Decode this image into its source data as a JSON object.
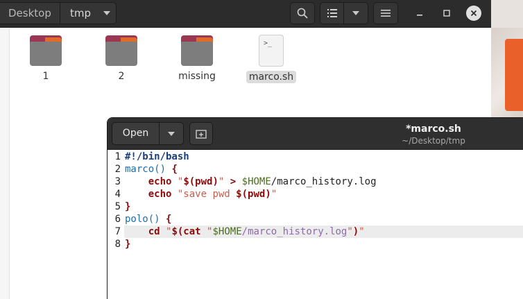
{
  "file_manager": {
    "pathbar": {
      "root": "Desktop",
      "current": "tmp"
    },
    "items": [
      {
        "label": "1",
        "type": "folder"
      },
      {
        "label": "2",
        "type": "folder"
      },
      {
        "label": "missing",
        "type": "folder"
      },
      {
        "label": "marco.sh",
        "type": "script",
        "icon_text": ">_",
        "selected": true
      }
    ]
  },
  "editor": {
    "open_label": "Open",
    "title": "*marco.sh",
    "subtitle": "~/Desktop/tmp",
    "current_line": 7,
    "line_numbers": [
      "1",
      "2",
      "3",
      "4",
      "5",
      "6",
      "7",
      "8"
    ],
    "lines": [
      {
        "indent": "",
        "tokens": [
          {
            "t": "#!/bin/bash",
            "c": "shebang"
          }
        ]
      },
      {
        "indent": "",
        "tokens": [
          {
            "t": "marco()",
            "c": "func"
          },
          {
            "t": " ",
            "c": "plain"
          },
          {
            "t": "{",
            "c": "kw"
          }
        ]
      },
      {
        "indent": "    ",
        "tokens": [
          {
            "t": "echo",
            "c": "kw"
          },
          {
            "t": " ",
            "c": "plain"
          },
          {
            "t": "\"",
            "c": "strlight"
          },
          {
            "t": "$(pwd)",
            "c": "kw"
          },
          {
            "t": "\"",
            "c": "strlight"
          },
          {
            "t": " ",
            "c": "plain"
          },
          {
            "t": ">",
            "c": "kw"
          },
          {
            "t": " ",
            "c": "plain"
          },
          {
            "t": "$HOME",
            "c": "var"
          },
          {
            "t": "/marco_history.log",
            "c": "plain"
          }
        ]
      },
      {
        "indent": "    ",
        "tokens": [
          {
            "t": "echo",
            "c": "kw"
          },
          {
            "t": " ",
            "c": "plain"
          },
          {
            "t": "\"save pwd ",
            "c": "strlight"
          },
          {
            "t": "$(pwd)",
            "c": "kw"
          },
          {
            "t": "\"",
            "c": "strlight"
          }
        ]
      },
      {
        "indent": "",
        "tokens": [
          {
            "t": "}",
            "c": "kw"
          }
        ]
      },
      {
        "indent": "",
        "tokens": [
          {
            "t": "polo()",
            "c": "func"
          },
          {
            "t": " ",
            "c": "plain"
          },
          {
            "t": "{",
            "c": "kw"
          }
        ]
      },
      {
        "indent": "    ",
        "tokens": [
          {
            "t": "cd",
            "c": "kw"
          },
          {
            "t": " ",
            "c": "plain"
          },
          {
            "t": "\"",
            "c": "strlight"
          },
          {
            "t": "$(cat",
            "c": "kw"
          },
          {
            "t": " ",
            "c": "plain"
          },
          {
            "t": "\"",
            "c": "strlight"
          },
          {
            "t": "$HOME",
            "c": "var"
          },
          {
            "t": "/marco_history.log",
            "c": "path"
          },
          {
            "t": "\"",
            "c": "strlight"
          },
          {
            "t": ")",
            "c": "kw"
          },
          {
            "t": "\"",
            "c": "strlight"
          }
        ]
      },
      {
        "indent": "",
        "tokens": [
          {
            "t": "}",
            "c": "kw"
          }
        ]
      }
    ]
  },
  "colors": {
    "accent_orange": "#e9602a",
    "folder_tab": "#9b3653",
    "folder_body": "#7d7d7d",
    "header_dark": "#2c2c2c"
  }
}
